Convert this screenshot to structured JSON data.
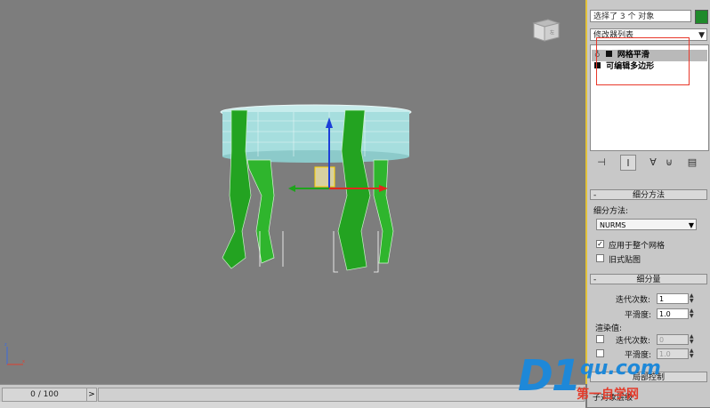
{
  "viewport": {
    "label": "3D viewport",
    "viewcube_icon": "viewcube-icon",
    "axis_icon": "axis-tripod-icon",
    "axis_z": "z",
    "axis_x": "x"
  },
  "timeline": {
    "frame_display": "0 / 100",
    "next_label": ">"
  },
  "panel": {
    "selection_name": "选择了 3 个 对象",
    "object_color": "#1f8a2a",
    "modifier_list": "修改器列表",
    "modifier_list_arrow": "▼",
    "stack": [
      {
        "label": "网格平滑",
        "selected": true
      },
      {
        "label": "可编辑多边形",
        "selected": false
      }
    ],
    "tools": [
      "pin-stack-icon",
      "show-end-result-icon",
      "make-unique-icon",
      "remove-modifier-icon",
      "configure-sets-icon"
    ]
  },
  "subdivision_method": {
    "title": "细分方法",
    "collapse": "-",
    "method_label": "细分方法:",
    "method_value": "NURMS",
    "dropdown_arrow": "▼",
    "apply_whole_mesh": {
      "label": "应用于整个网格",
      "checked": true
    },
    "old_mapping": {
      "label": "旧式贴图",
      "checked": false
    }
  },
  "subdivision_amount": {
    "title": "细分量",
    "collapse": "-",
    "iterations_label": "迭代次数:",
    "iterations_value": "1",
    "smoothness_label": "平滑度:",
    "smoothness_value": "1.0",
    "render_values_label": "渲染值:",
    "render_iterations_label": "迭代次数:",
    "render_iterations_value": "0",
    "render_smoothness_label": "平滑度:",
    "render_smoothness_value": "1.0"
  },
  "next_rollout": {
    "title": "局部控制",
    "partial_label": "子对象层级"
  },
  "watermark": {
    "logo": "D1",
    "url": "qu.com",
    "tagline": "第一自学网"
  },
  "colors": {
    "accent_yellow": "#e2c23a",
    "selection_red": "#e8382b",
    "stool_green": "#23a321",
    "stool_top": "#a6dede",
    "watermark_blue": "#1e88d8"
  }
}
